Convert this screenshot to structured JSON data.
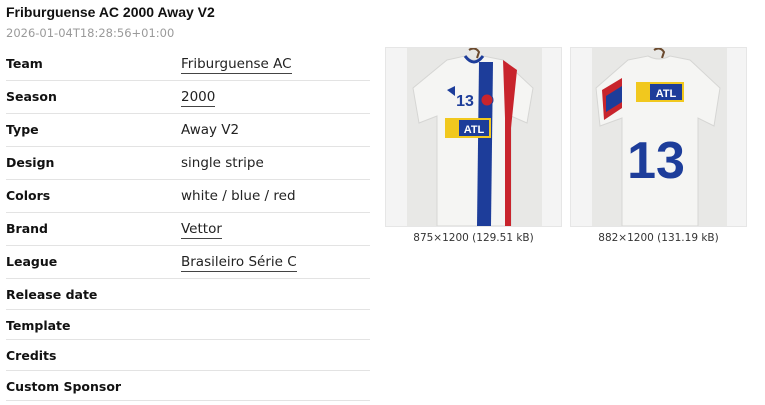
{
  "header": {
    "title": "Friburguense AC 2000 Away V2",
    "timestamp": "2026-01-04T18:28:56+01:00"
  },
  "details": [
    {
      "label": "Team",
      "value": "Friburguense AC",
      "link": true
    },
    {
      "label": "Season",
      "value": "2000",
      "link": true
    },
    {
      "label": "Type",
      "value": "Away V2",
      "link": false
    },
    {
      "label": "Design",
      "value": "single stripe",
      "link": false
    },
    {
      "label": "Colors",
      "value": "white / blue / red",
      "link": false
    },
    {
      "label": "Brand",
      "value": "Vettor",
      "link": true
    },
    {
      "label": "League",
      "value": "Brasileiro Série C",
      "link": true
    },
    {
      "label": "Release date",
      "value": "",
      "link": false
    },
    {
      "label": "Template",
      "value": "",
      "link": false
    },
    {
      "label": "Credits",
      "value": "",
      "link": false
    },
    {
      "label": "Custom Sponsor",
      "value": "",
      "link": false
    }
  ],
  "gallery": [
    {
      "caption": "875×1200 (129.51 kB)",
      "sponsor": "ATL",
      "number": "13",
      "view": "front"
    },
    {
      "caption": "882×1200 (131.19 kB)",
      "sponsor": "ATL",
      "number": "13",
      "view": "back"
    }
  ],
  "colors": {
    "shirt": "#f5f5f3",
    "stripe_blue": "#1d3d9a",
    "stripe_red": "#c8242c",
    "sponsor_yellow": "#f1c81e",
    "hanger": "#6b4a2e"
  }
}
